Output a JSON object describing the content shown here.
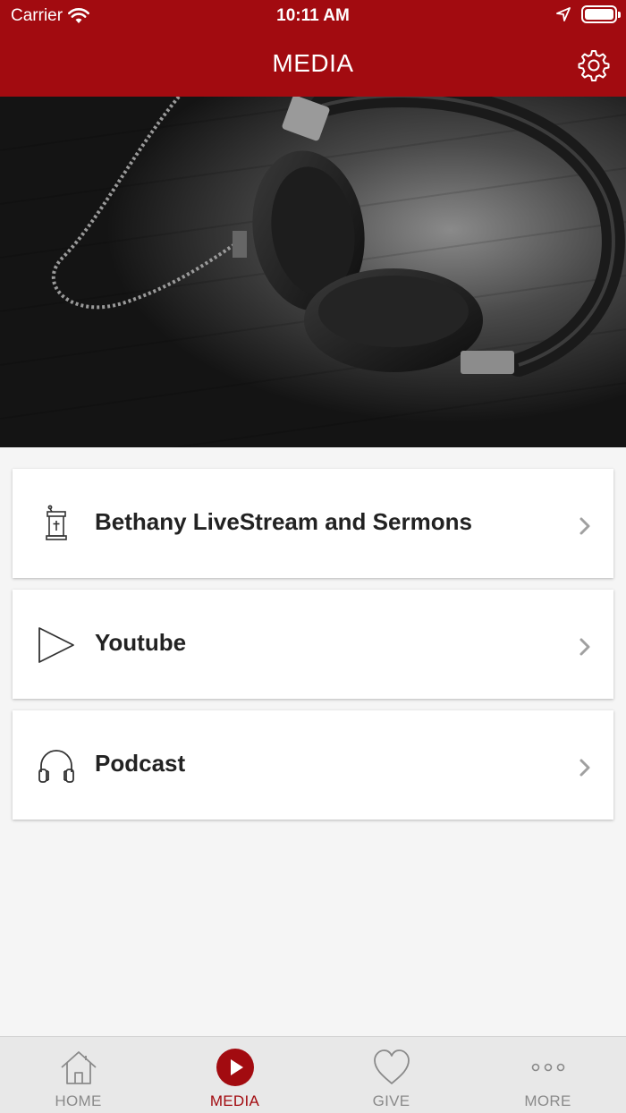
{
  "status": {
    "carrier": "Carrier",
    "time": "10:11 AM"
  },
  "header": {
    "title": "MEDIA"
  },
  "menu": [
    {
      "label": "Bethany LiveStream and Sermons",
      "icon": "pulpit-icon"
    },
    {
      "label": "Youtube",
      "icon": "play-outline-icon"
    },
    {
      "label": "Podcast",
      "icon": "headphones-icon"
    }
  ],
  "tabs": [
    {
      "label": "HOME",
      "icon": "home-icon",
      "active": false
    },
    {
      "label": "MEDIA",
      "icon": "play-circle-icon",
      "active": true
    },
    {
      "label": "GIVE",
      "icon": "heart-icon",
      "active": false
    },
    {
      "label": "MORE",
      "icon": "more-dots-icon",
      "active": false
    }
  ],
  "colors": {
    "brand": "#a20b10",
    "background": "#f5f5f5",
    "tab_inactive": "#8a8a8a"
  }
}
